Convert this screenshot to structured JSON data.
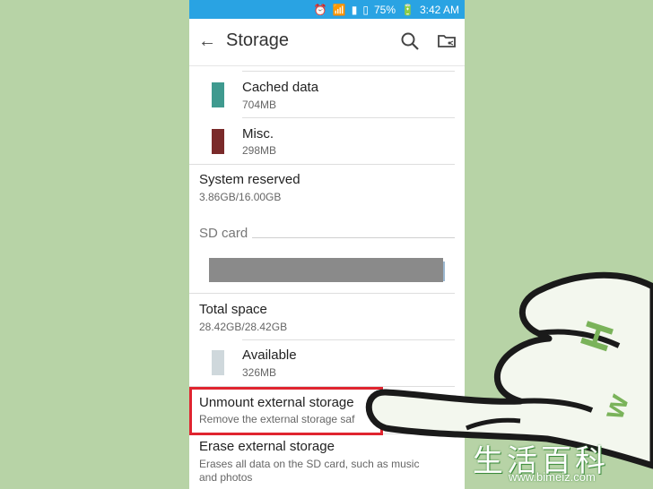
{
  "statusbar": {
    "battery": "75%",
    "time": "3:42 AM"
  },
  "appbar": {
    "title": "Storage"
  },
  "items": {
    "cached": {
      "label": "Cached data",
      "value": "704MB",
      "color": "#3f9a8f"
    },
    "misc": {
      "label": "Misc.",
      "value": "298MB",
      "color": "#7a2a2a"
    },
    "system_reserved": {
      "label": "System reserved",
      "value": "3.86GB/16.00GB"
    },
    "sd_card": {
      "header": "SD card"
    },
    "total_space": {
      "label": "Total space",
      "value": "28.42GB/28.42GB"
    },
    "available": {
      "label": "Available",
      "value": "326MB",
      "color": "#cfd8dc"
    },
    "unmount": {
      "label": "Unmount external storage",
      "description": "Remove the external storage saf"
    },
    "erase": {
      "label": "Erase external storage",
      "description_line1": "Erases all data on the SD card, such as music",
      "description_line2": "and photos"
    }
  },
  "watermark": {
    "chinese": "生活百科",
    "url": "www.bimeiz.com"
  }
}
